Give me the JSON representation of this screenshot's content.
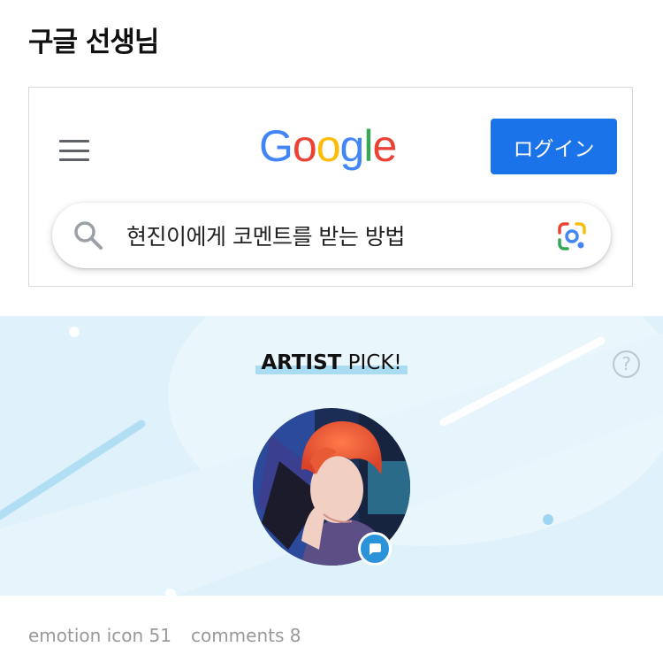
{
  "post": {
    "title": "구글 선생님"
  },
  "google": {
    "logo_letters": [
      {
        "char": "G",
        "color": "#4285F4"
      },
      {
        "char": "o",
        "color": "#EA4335"
      },
      {
        "char": "o",
        "color": "#FBBC05"
      },
      {
        "char": "g",
        "color": "#4285F4"
      },
      {
        "char": "l",
        "color": "#34A853"
      },
      {
        "char": "e",
        "color": "#EA4335"
      }
    ],
    "login_label": "ログイン",
    "login_color": "#1a73e8",
    "search_query": "현진이에게 코멘트를 받는 방법",
    "menu_icon": "hamburger-menu-icon",
    "search_icon": "magnifier-icon",
    "lens_icon": "google-lens-icon"
  },
  "artist_pick": {
    "title_bold": "ARTIST",
    "title_rest": " PICK!",
    "help_glyph": "?",
    "banner_color": "#dff1fb",
    "badge_color": "#2b93d9",
    "avatar_icon": "artist-avatar-photo",
    "badge_icon": "chat-bubble-icon"
  },
  "stats": {
    "emotion": "emotion icon 51",
    "comments": "comments 8"
  }
}
